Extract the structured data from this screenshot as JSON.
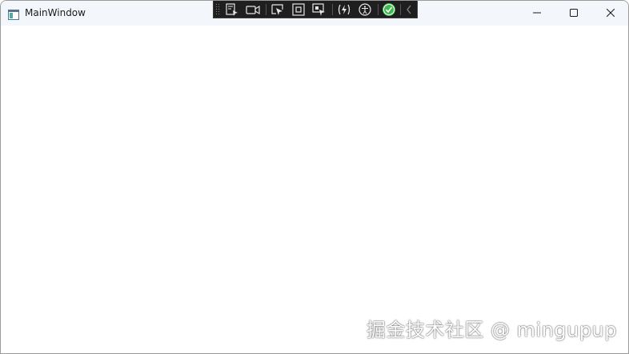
{
  "window": {
    "title": "MainWindow"
  },
  "icons": {
    "app": "window-app-icon",
    "minimize": "minimize-icon",
    "maximize": "maximize-icon",
    "close": "close-icon"
  },
  "xaml_toolbar": {
    "tools": [
      "go-to-live-visual-tree-icon",
      "select-element-camera-icon",
      "select-element-icon",
      "display-layout-adorners-icon",
      "track-focus-icon",
      "hot-reload-icon",
      "accessibility-icon",
      "check-status-icon",
      "collapse-chevron-icon"
    ],
    "status_color": "#3fb950"
  },
  "watermark": {
    "text": "掘金技术社区 @ mingupup"
  }
}
